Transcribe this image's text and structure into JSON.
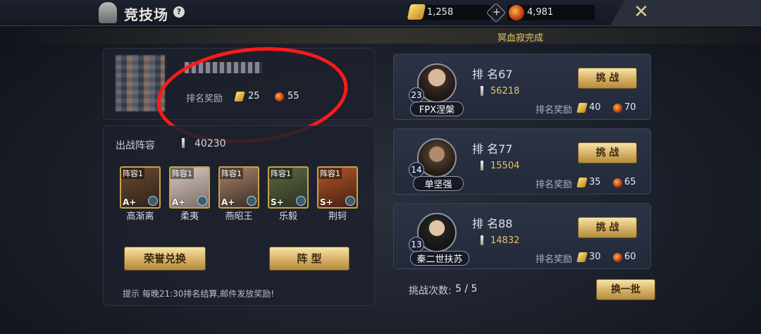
{
  "header": {
    "title": "竞技场",
    "help": "?",
    "gold": "1,258",
    "orb": "4,981"
  },
  "banner": {
    "text": "冥血寂完成"
  },
  "player": {
    "reward_label": "排名奖励",
    "reward_gold": "25",
    "reward_orb": "55"
  },
  "lineup": {
    "label": "出战阵容",
    "power": "40230",
    "heroes": [
      {
        "tag": "阵容1",
        "grade": "A+",
        "name": "高渐离"
      },
      {
        "tag": "阵容1",
        "grade": "A+",
        "name": "柔夷"
      },
      {
        "tag": "阵容1",
        "grade": "A+",
        "name": "燕昭王"
      },
      {
        "tag": "阵容1",
        "grade": "S+",
        "name": "乐毅"
      },
      {
        "tag": "阵容1",
        "grade": "S+",
        "name": "荆轲"
      }
    ],
    "honor_button": "荣誉兑换",
    "formation_button": "阵 型",
    "tip": "提示 每晚21:30排名结算,邮件发放奖励!"
  },
  "opponents": [
    {
      "level": "23",
      "name": "FPX涅槃",
      "rank": "排 名67",
      "power": "56218",
      "reward_label": "排名奖励",
      "gold": "40",
      "orb": "70",
      "button": "挑 战"
    },
    {
      "level": "14",
      "name": "单坚强",
      "rank": "排 名77",
      "power": "15504",
      "reward_label": "排名奖励",
      "gold": "35",
      "orb": "65",
      "button": "挑 战"
    },
    {
      "level": "13",
      "name": "秦二世扶苏",
      "rank": "排 名88",
      "power": "14832",
      "reward_label": "排名奖励",
      "gold": "30",
      "orb": "60",
      "button": "挑 战"
    }
  ],
  "footer": {
    "challenge_label": "挑战次数:",
    "challenge_count": "5 / 5",
    "refresh_button": "换一批"
  }
}
